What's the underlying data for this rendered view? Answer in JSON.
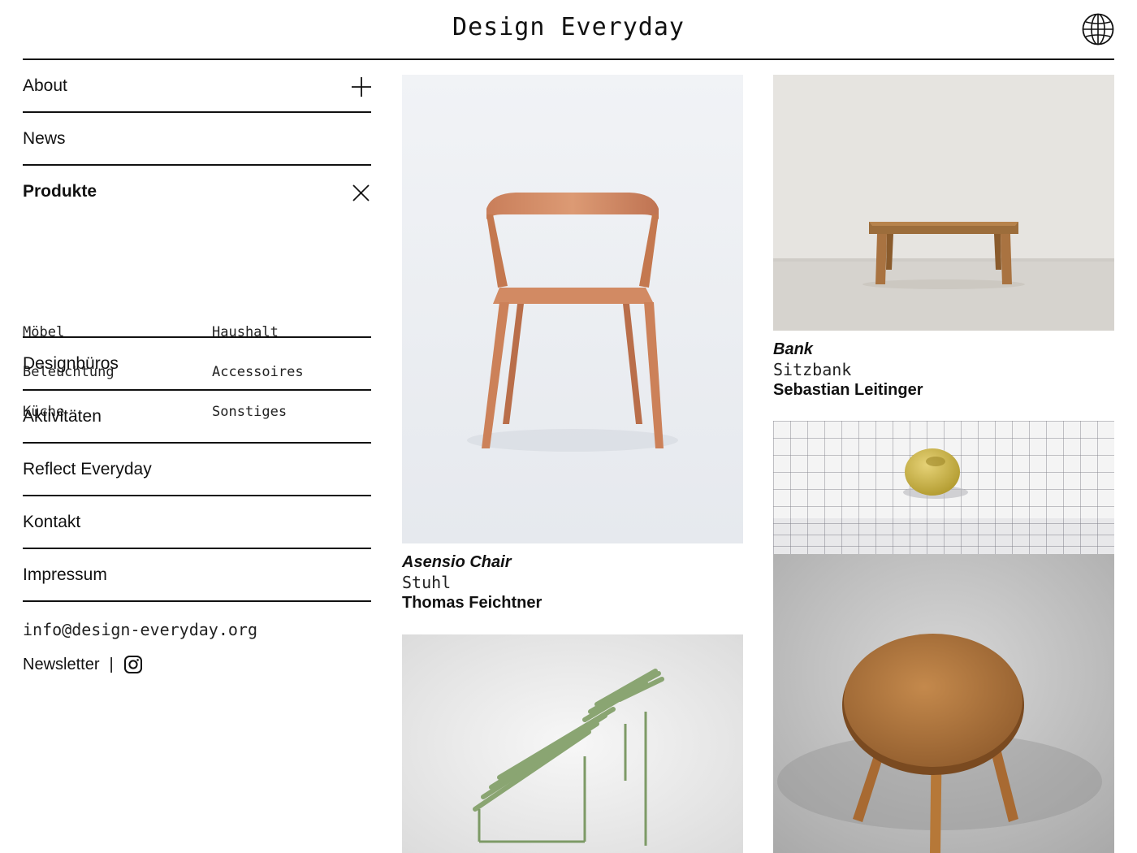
{
  "header": {
    "title": "Design Everyday",
    "language_icon": "globe-icon"
  },
  "nav": {
    "items": [
      {
        "label": "About",
        "icon": "plus-icon"
      },
      {
        "label": "News"
      },
      {
        "label": "Produkte",
        "icon": "close-icon",
        "expanded": true,
        "subitems": [
          "Möbel",
          "Haushalt",
          "Beleuchtung",
          "Accessoires",
          "Küche",
          "Sonstiges"
        ]
      },
      {
        "label": "Designbüros"
      },
      {
        "label": "Aktivitäten"
      },
      {
        "label": "Reflect Everyday"
      },
      {
        "label": "Kontakt"
      },
      {
        "label": "Impressum"
      }
    ]
  },
  "contact": {
    "email": "info@design-everyday.org",
    "newsletter": "Newsletter",
    "separator": "|",
    "social_icon": "instagram-icon"
  },
  "products": [
    {
      "name": "Asensio Chair",
      "type": "Stuhl",
      "designer": "Thomas Feichtner"
    },
    {
      "name": "Bank",
      "type": "Sitzbank",
      "designer": "Sebastian Leitinger"
    }
  ],
  "colors": {
    "text": "#111111",
    "rule": "#111111",
    "background": "#ffffff"
  }
}
